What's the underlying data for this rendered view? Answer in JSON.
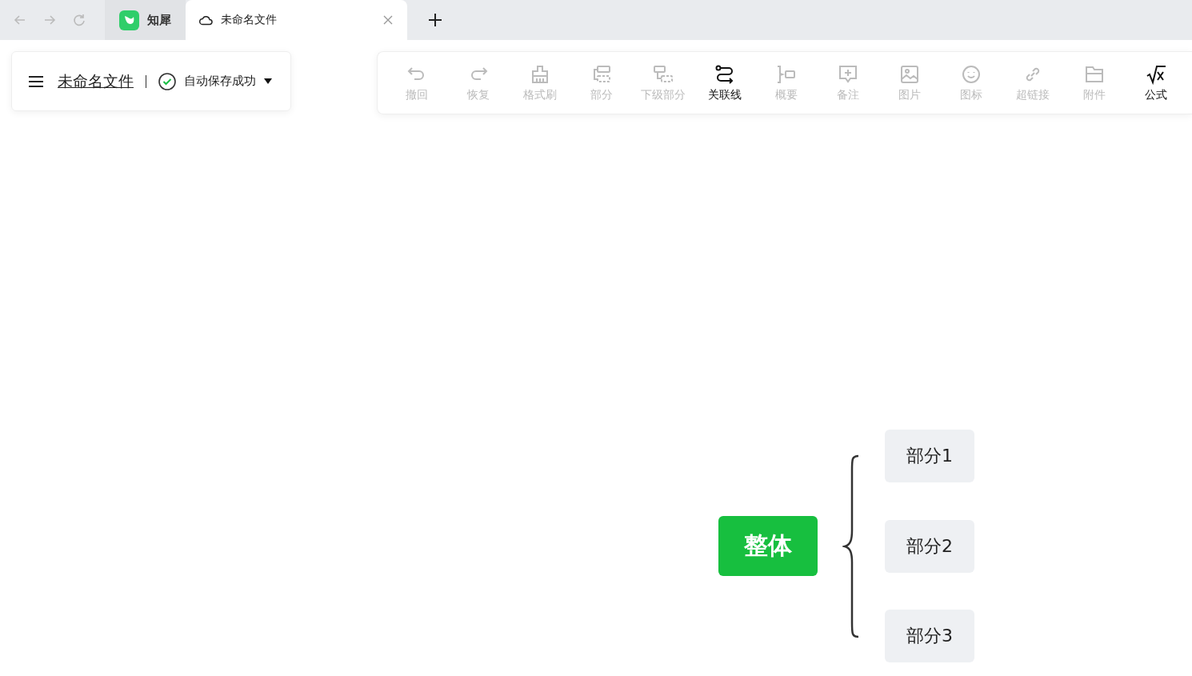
{
  "browser_tabs": [
    {
      "kind": "app",
      "label": "知犀",
      "selected": false
    },
    {
      "kind": "doc",
      "label": "未命名文件",
      "selected": true
    }
  ],
  "file_panel": {
    "title": "未命名文件",
    "save_status": "自动保存成功"
  },
  "toolbar": [
    {
      "kind": "undo",
      "label": "撤回",
      "disabled": true
    },
    {
      "kind": "redo",
      "label": "恢复",
      "disabled": true
    },
    {
      "kind": "brush",
      "label": "格式刷",
      "disabled": true
    },
    {
      "kind": "part",
      "label": "部分",
      "disabled": true
    },
    {
      "kind": "subpart",
      "label": "下级部分",
      "disabled": true
    },
    {
      "kind": "relation",
      "label": "关联线",
      "disabled": false
    },
    {
      "kind": "summary",
      "label": "概要",
      "disabled": true
    },
    {
      "kind": "note",
      "label": "备注",
      "disabled": true
    },
    {
      "kind": "image",
      "label": "图片",
      "disabled": true
    },
    {
      "kind": "emoji",
      "label": "图标",
      "disabled": true
    },
    {
      "kind": "link",
      "label": "超链接",
      "disabled": true
    },
    {
      "kind": "attach",
      "label": "附件",
      "disabled": true
    },
    {
      "kind": "formula",
      "label": "公式",
      "disabled": false
    }
  ],
  "mind_map": {
    "root": "整体",
    "children": [
      "部分1",
      "部分2",
      "部分3"
    ]
  }
}
